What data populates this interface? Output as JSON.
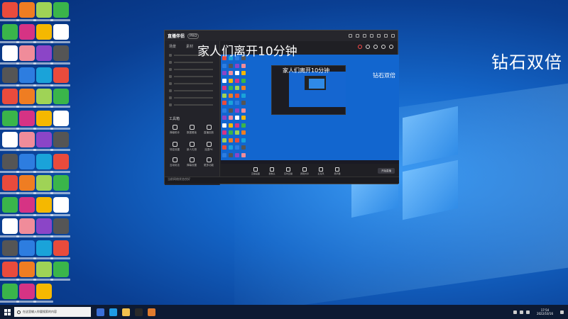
{
  "overlays": {
    "main_text": "家人们离开10分钟",
    "right_text": "钻石双倍",
    "inner_caption": "家人们离开10分钟",
    "inner_right": "钻石双倍"
  },
  "app": {
    "logo": "直播伴侣",
    "badge": "PRO",
    "sidebar_tabs": [
      "场景",
      "素材"
    ],
    "tool_section_label": "工具箱",
    "tools": [
      "弹幕助手",
      "数据看板",
      "直播回放",
      "场控设置",
      "新人礼物",
      "连麦PK",
      "互动玩法",
      "弹幕设置",
      "更多功能"
    ],
    "footer_text": "当前网络状态良好",
    "bottom_controls": [
      "直播画面",
      "摄像头",
      "实时直播",
      "屏幕共享",
      "麦克风",
      "扬声器"
    ],
    "start_button": "开始直播",
    "colors": {
      "window_bg": "#1f1f24",
      "accent_red": "#ff4a4a"
    }
  },
  "taskbar": {
    "search_placeholder": "在这里输入你要搜索的内容",
    "time": "17:54",
    "date": "2022/10/16"
  }
}
